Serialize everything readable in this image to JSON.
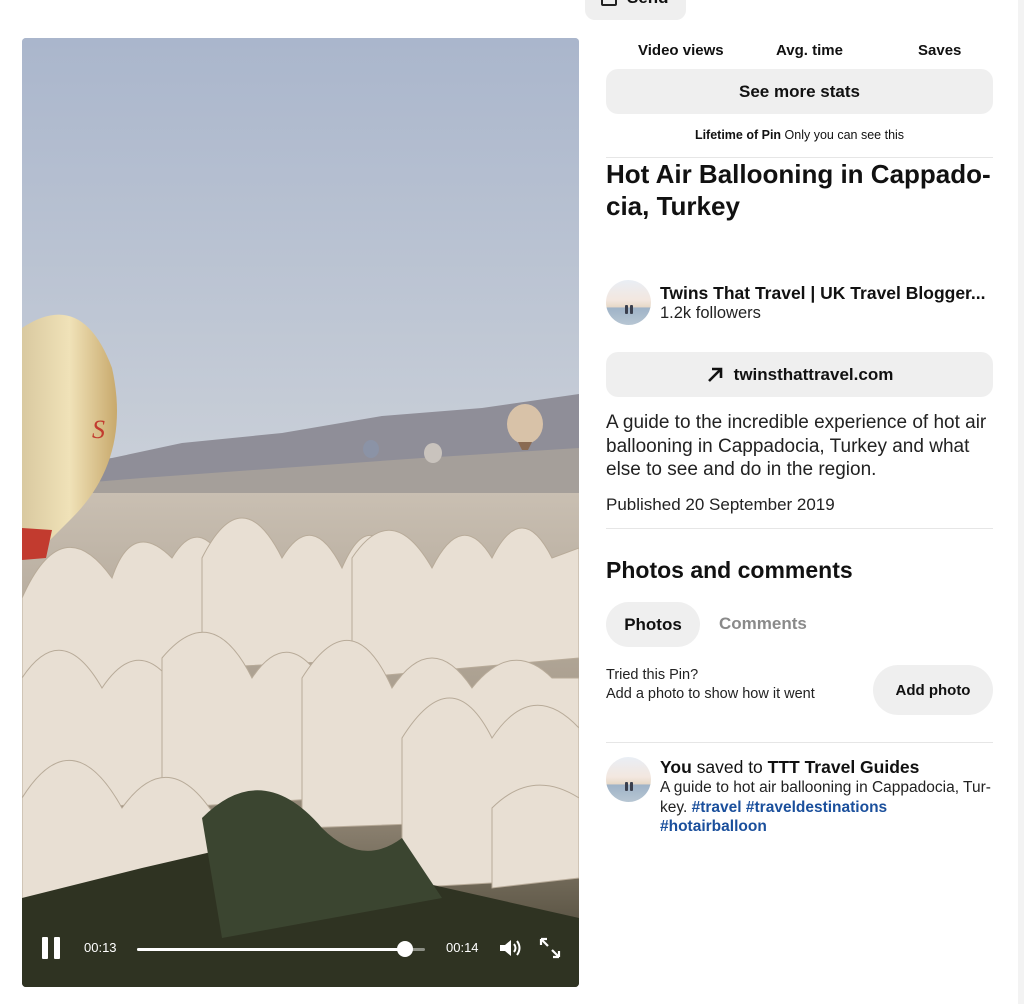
{
  "header": {
    "send_label": "Send"
  },
  "video": {
    "current_time": "00:13",
    "duration": "00:14",
    "progress_fraction": 0.93,
    "balloon_text": "S"
  },
  "stats": {
    "headers": [
      "Video views",
      "Avg. time",
      "Saves"
    ],
    "more_button": "See more stats",
    "lifetime_label": "Lifetime of Pin",
    "lifetime_note": "Only you can see this"
  },
  "pin": {
    "title_line1": "Hot Air Ballooning in Cappado-",
    "title_line2": "cia, Turkey",
    "creator_name": "Twins That Travel | UK Travel Blogger...",
    "creator_followers": "1.2k followers",
    "link": "twinsthattravel.com",
    "description": "A guide to the incredible experience of hot air ballooning in Cappadocia, Turkey and what else to see and do in the region.",
    "published": "Published 20 September 2019"
  },
  "photos_comments": {
    "title": "Photos and comments",
    "tabs": [
      "Photos",
      "Comments"
    ],
    "tried_line1": "Tried this Pin?",
    "tried_line2": "Add a photo to show how it went",
    "add_photo_button": "Add photo"
  },
  "activity": {
    "user": "You",
    "action": " saved to ",
    "board": "TTT Travel Guides",
    "description_line1": "A guide to hot air ballooning in Cappadocia, Tur-",
    "description_line2_prefix": "key. ",
    "hashtags": [
      "#travel",
      "#traveldestinations",
      "#hotairballoon"
    ]
  },
  "colors": {
    "button_bg": "#efefef",
    "hashtag": "#1a4f9c",
    "muted_tab": "#8a8a8a"
  },
  "icons": [
    "send-icon",
    "pause-icon",
    "volume-icon",
    "fullscreen-icon",
    "arrow-up-right-icon"
  ]
}
